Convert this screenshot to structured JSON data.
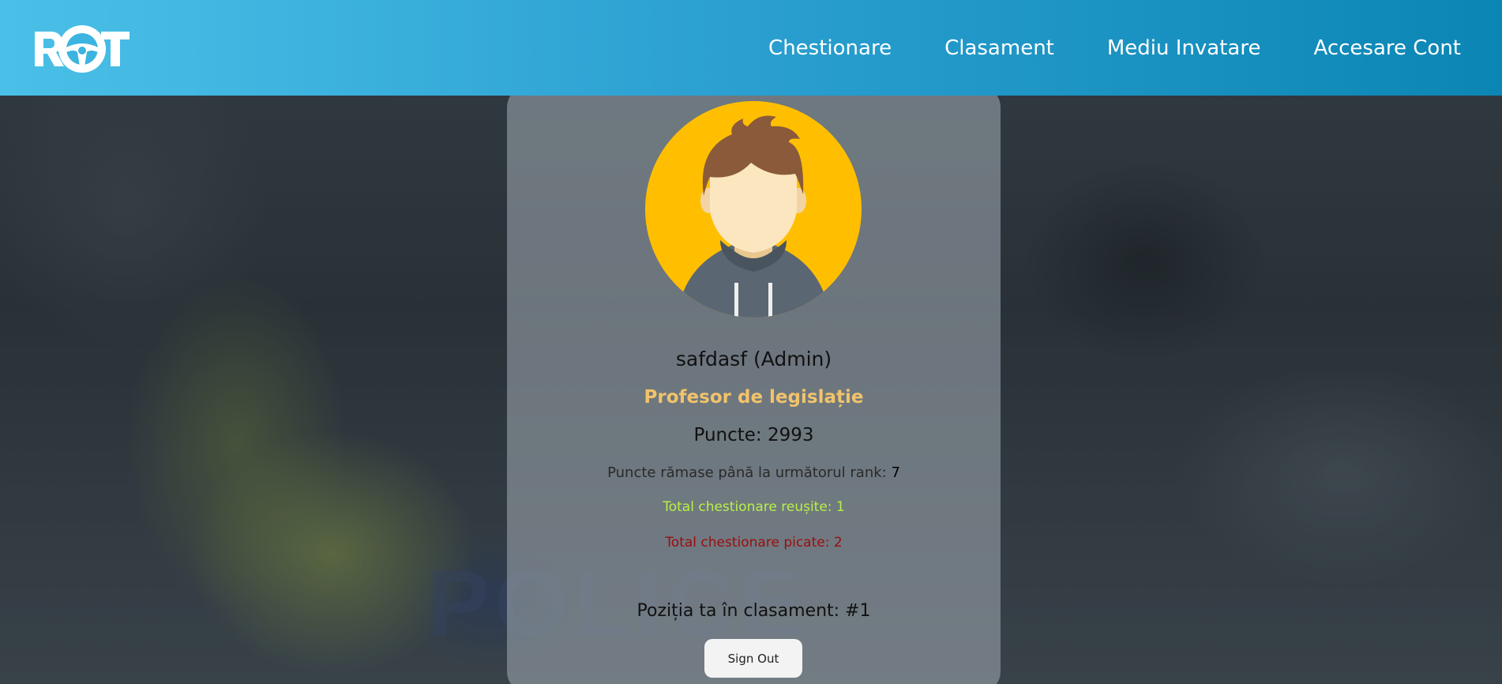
{
  "header": {
    "logo_text": "ROT",
    "nav": [
      {
        "label": "Chestionare"
      },
      {
        "label": "Clasament"
      },
      {
        "label": "Mediu Invatare"
      },
      {
        "label": "Accesare Cont"
      }
    ]
  },
  "background": {
    "watermark_text": "POLICE"
  },
  "profile": {
    "username": "safdasf (Admin)",
    "rank": "Profesor de legislație",
    "points": "Puncte: 2993",
    "remaining_label": "Puncte rămase până la următorul rank: ",
    "remaining_value": "7",
    "passed": "Total chestionare reușite: 1",
    "failed": "Total chestionare picate: 2",
    "position": "Poziția ta în clasament: #1",
    "signout_label": "Sign Out"
  },
  "colors": {
    "header_start": "#4ac0e8",
    "header_end": "#0b86b4",
    "rank": "#f1c36b",
    "passed": "#b8f046",
    "failed": "#9b0d0d",
    "avatar_bg": "#ffbf00"
  }
}
